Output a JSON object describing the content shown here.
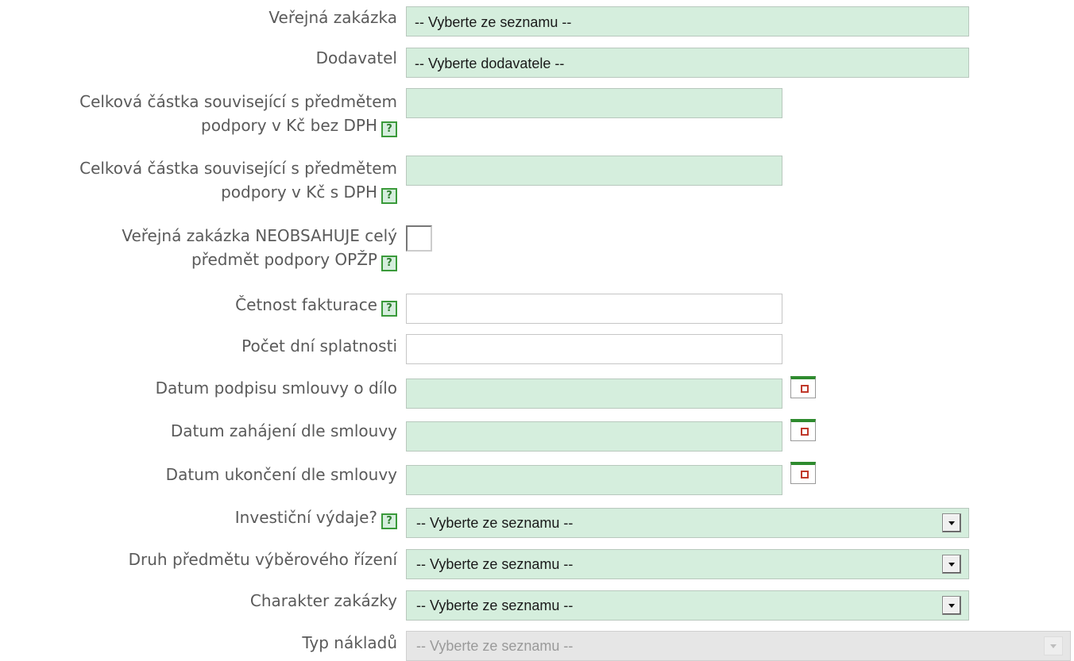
{
  "form": {
    "verejna_zakazka": {
      "label": "Veřejná zakázka",
      "value": "-- Vyberte ze seznamu --"
    },
    "dodavatel": {
      "label": "Dodavatel",
      "value": "-- Vyberte dodavatele --"
    },
    "castka_bez_dph": {
      "label_line1": "Celková částka související s předmětem",
      "label_line2": "podpory v Kč bez DPH",
      "value": ""
    },
    "castka_s_dph": {
      "label_line1": "Celková částka související s předmětem",
      "label_line2": "podpory v Kč s DPH",
      "value": ""
    },
    "neobsahuje": {
      "label_line1": "Veřejná zakázka NEOBSAHUJE celý",
      "label_line2": "předmět podpory OPŽP",
      "checked": false
    },
    "cetnost_fakturace": {
      "label": "Četnost fakturace",
      "value": ""
    },
    "pocet_dni_splatnosti": {
      "label": "Počet dní splatnosti",
      "value": ""
    },
    "datum_podpisu": {
      "label": "Datum podpisu smlouvy o dílo",
      "value": ""
    },
    "datum_zahajeni": {
      "label": "Datum zahájení dle smlouvy",
      "value": ""
    },
    "datum_ukonceni": {
      "label": "Datum ukončení dle smlouvy",
      "value": ""
    },
    "investicni_vydaje": {
      "label": "Investiční výdaje?",
      "value": "-- Vyberte ze seznamu --"
    },
    "druh_predmetu": {
      "label": "Druh předmětu výběrového řízení",
      "value": "-- Vyberte ze seznamu --"
    },
    "charakter_zakazky": {
      "label": "Charakter zakázky",
      "value": "-- Vyberte ze seznamu --"
    },
    "typ_nakladu": {
      "label": "Typ nákladů",
      "value": "-- Vyberte ze seznamu --",
      "disabled": true
    }
  },
  "help_glyph": "?",
  "icons": {
    "help": "help-icon",
    "calendar": "calendar-icon",
    "dropdown": "chevron-down-icon"
  },
  "colors": {
    "field_required_bg": "#d5eedd",
    "label_text": "#5a5a5a",
    "disabled_bg": "#e6e6e6",
    "calendar_accent": "#2e8b2e"
  }
}
